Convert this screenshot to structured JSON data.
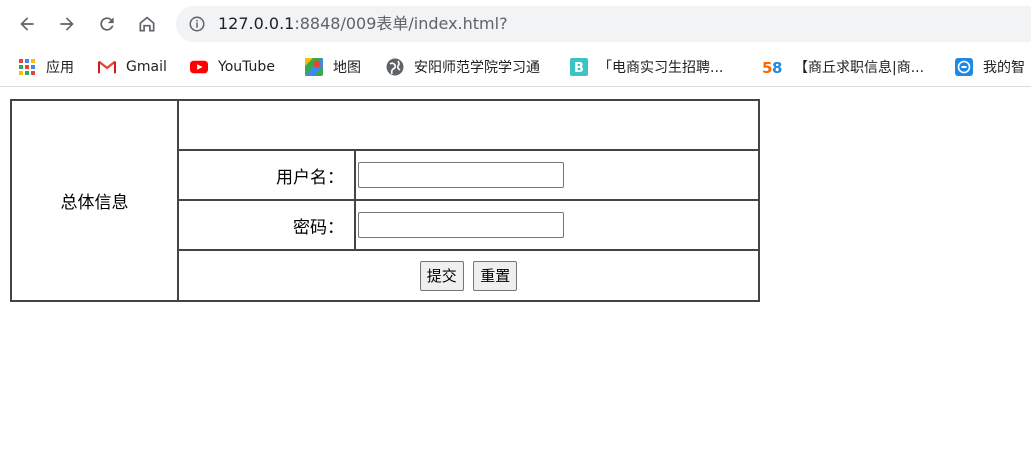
{
  "browser": {
    "url_host": "127.0.0.1",
    "url_rest": ":8848/009表单/index.html?"
  },
  "bookmarks": [
    {
      "label": "应用",
      "icon": "apps-grid-icon"
    },
    {
      "label": "Gmail",
      "icon": "gmail-icon"
    },
    {
      "label": "YouTube",
      "icon": "youtube-icon"
    },
    {
      "label": "地图",
      "icon": "maps-icon"
    },
    {
      "label": "安阳师范学院学习通",
      "icon": "globe-icon"
    },
    {
      "label": "「电商实习生招聘...",
      "icon": "b-logo-icon"
    },
    {
      "label": "【商丘求职信息|商...",
      "icon": "58-logo-icon"
    },
    {
      "label": "我的智",
      "icon": "zhi-logo-icon"
    }
  ],
  "form": {
    "left_title": "总体信息",
    "username_label": "用户名：",
    "username_value": "",
    "password_label": "密码：",
    "password_value": "",
    "submit_label": "提交",
    "reset_label": "重置"
  },
  "colors": {
    "border": "#444444",
    "omnibox_bg": "#f1f3f4",
    "youtube_red": "#ff0000",
    "gmail_red": "#ea4335"
  }
}
